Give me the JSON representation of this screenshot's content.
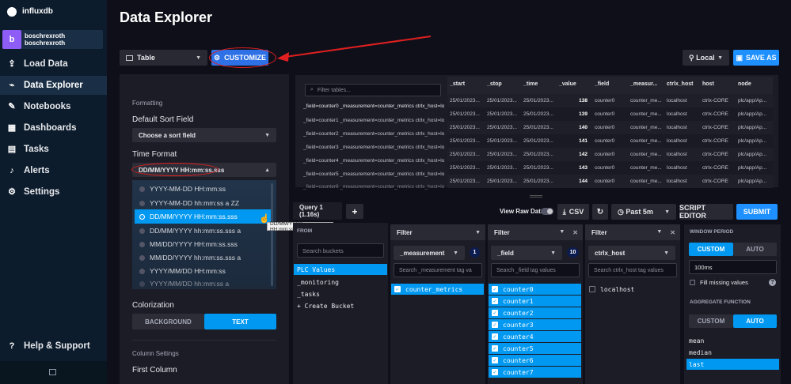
{
  "sidebar": {
    "logo_text": "influxdb",
    "org_initial": "b",
    "org_name": "boschrexroth",
    "org_user": "boschrexroth",
    "items": [
      {
        "label": "Load Data",
        "icon": "upload-icon"
      },
      {
        "label": "Data Explorer",
        "icon": "chart-icon"
      },
      {
        "label": "Notebooks",
        "icon": "pencil-icon"
      },
      {
        "label": "Dashboards",
        "icon": "dashboards-icon"
      },
      {
        "label": "Tasks",
        "icon": "calendar-icon"
      },
      {
        "label": "Alerts",
        "icon": "bell-icon"
      },
      {
        "label": "Settings",
        "icon": "gear-icon"
      }
    ],
    "help": "Help & Support"
  },
  "header": {
    "title": "Data Explorer",
    "viz_type": "Table",
    "customize": "CUSTOMIZE",
    "timezone": "Local",
    "save_as": "SAVE AS"
  },
  "customize_panel": {
    "section": "Formatting",
    "sort_label": "Default Sort Field",
    "sort_value": "Choose a sort field",
    "time_label": "Time Format",
    "time_value": "DD/MM/YYYY HH:mm:ss.sss",
    "options": [
      "YYYY-MM-DD HH:mm:ss",
      "YYYY-MM-DD hh:mm:ss a ZZ",
      "DD/MM/YYYY HH:mm:ss.sss",
      "DD/MM/YYYY hh:mm:ss.sss a",
      "MM/DD/YYYY HH:mm:ss.sss",
      "MM/DD/YYYY hh:mm:ss.sss a",
      "YYYY/MM/DD HH:mm:ss",
      "YYYY/MM/DD hh:mm:ss a"
    ],
    "tooltip": "DD/MM/YYYY HH:mm:ss.sss",
    "colorization_label": "Colorization",
    "color_bg": "BACKGROUND",
    "color_text": "TEXT",
    "column_settings": "Column Settings",
    "first_column": "First Column"
  },
  "table": {
    "filter_placeholder": "Filter tables...",
    "tables": [
      "_field=counter0 _measurement=counter_metrics ctrlx_host=localhost",
      "_field=counter1 _measurement=counter_metrics ctrlx_host=localhost",
      "_field=counter2 _measurement=counter_metrics ctrlx_host=localhost",
      "_field=counter3 _measurement=counter_metrics ctrlx_host=localhost",
      "_field=counter4 _measurement=counter_metrics ctrlx_host=localhost",
      "_field=counter5 _measurement=counter_metrics ctrlx_host=localhost",
      "_field=counter6 _measurement=counter_metrics ctrlx_host=localhost"
    ],
    "columns": [
      "_start",
      "_stop",
      "_time",
      "_value",
      "_field",
      "_measur...",
      "ctrlx_host",
      "host",
      "node"
    ],
    "rows": [
      [
        "25/01/2023...",
        "25/01/2023...",
        "25/01/2023...",
        "138",
        "counter0",
        "counter_me...",
        "localhost",
        "ctrlx-CORE",
        "plc/app/Ap..."
      ],
      [
        "25/01/2023...",
        "25/01/2023...",
        "25/01/2023...",
        "139",
        "counter0",
        "counter_me...",
        "localhost",
        "ctrlx-CORE",
        "plc/app/Ap..."
      ],
      [
        "25/01/2023...",
        "25/01/2023...",
        "25/01/2023...",
        "140",
        "counter0",
        "counter_me...",
        "localhost",
        "ctrlx-CORE",
        "plc/app/Ap..."
      ],
      [
        "25/01/2023...",
        "25/01/2023...",
        "25/01/2023...",
        "141",
        "counter0",
        "counter_me...",
        "localhost",
        "ctrlx-CORE",
        "plc/app/Ap..."
      ],
      [
        "25/01/2023...",
        "25/01/2023...",
        "25/01/2023...",
        "142",
        "counter0",
        "counter_me...",
        "localhost",
        "ctrlx-CORE",
        "plc/app/Ap..."
      ],
      [
        "25/01/2023...",
        "25/01/2023...",
        "25/01/2023...",
        "143",
        "counter0",
        "counter_me...",
        "localhost",
        "ctrlx-CORE",
        "plc/app/Ap..."
      ],
      [
        "25/01/2023...",
        "25/01/2023...",
        "25/01/2023...",
        "144",
        "counter0",
        "counter_me...",
        "localhost",
        "ctrlx-CORE",
        "plc/app/Ap..."
      ]
    ]
  },
  "query": {
    "tab": "Query 1 (1.16s)",
    "add": "+",
    "view_raw": "View Raw Data",
    "csv": "CSV",
    "refresh": "↻",
    "range": "Past 5m",
    "script_editor": "SCRIPT EDITOR",
    "submit": "SUBMIT",
    "from_label": "FROM",
    "bucket_search": "Search buckets",
    "buckets": [
      "PLC Values",
      "_monitoring",
      "_tasks",
      "+ Create Bucket"
    ],
    "filter_label": "Filter",
    "filters": [
      {
        "key": "_measurement",
        "count": "1",
        "search": "Search _measurement tag va",
        "items": [
          "counter_metrics"
        ]
      },
      {
        "key": "_field",
        "count": "10",
        "search": "Search _field tag values",
        "items": [
          "counter0",
          "counter1",
          "counter2",
          "counter3",
          "counter4",
          "counter5",
          "counter6",
          "counter7"
        ]
      },
      {
        "key": "ctrlx_host",
        "count": "",
        "search": "Search ctrlx_host tag values",
        "items": [
          "localhost"
        ]
      }
    ],
    "window_period": "WINDOW PERIOD",
    "custom": "CUSTOM",
    "auto": "AUTO",
    "period_value": "100ms",
    "fill_missing": "Fill missing values",
    "aggregate": "AGGREGATE FUNCTION",
    "functions": [
      "mean",
      "median",
      "last"
    ]
  },
  "colors": {
    "accent": "#0098f0",
    "annotation": "#e02020",
    "save": "#1e90ff"
  }
}
